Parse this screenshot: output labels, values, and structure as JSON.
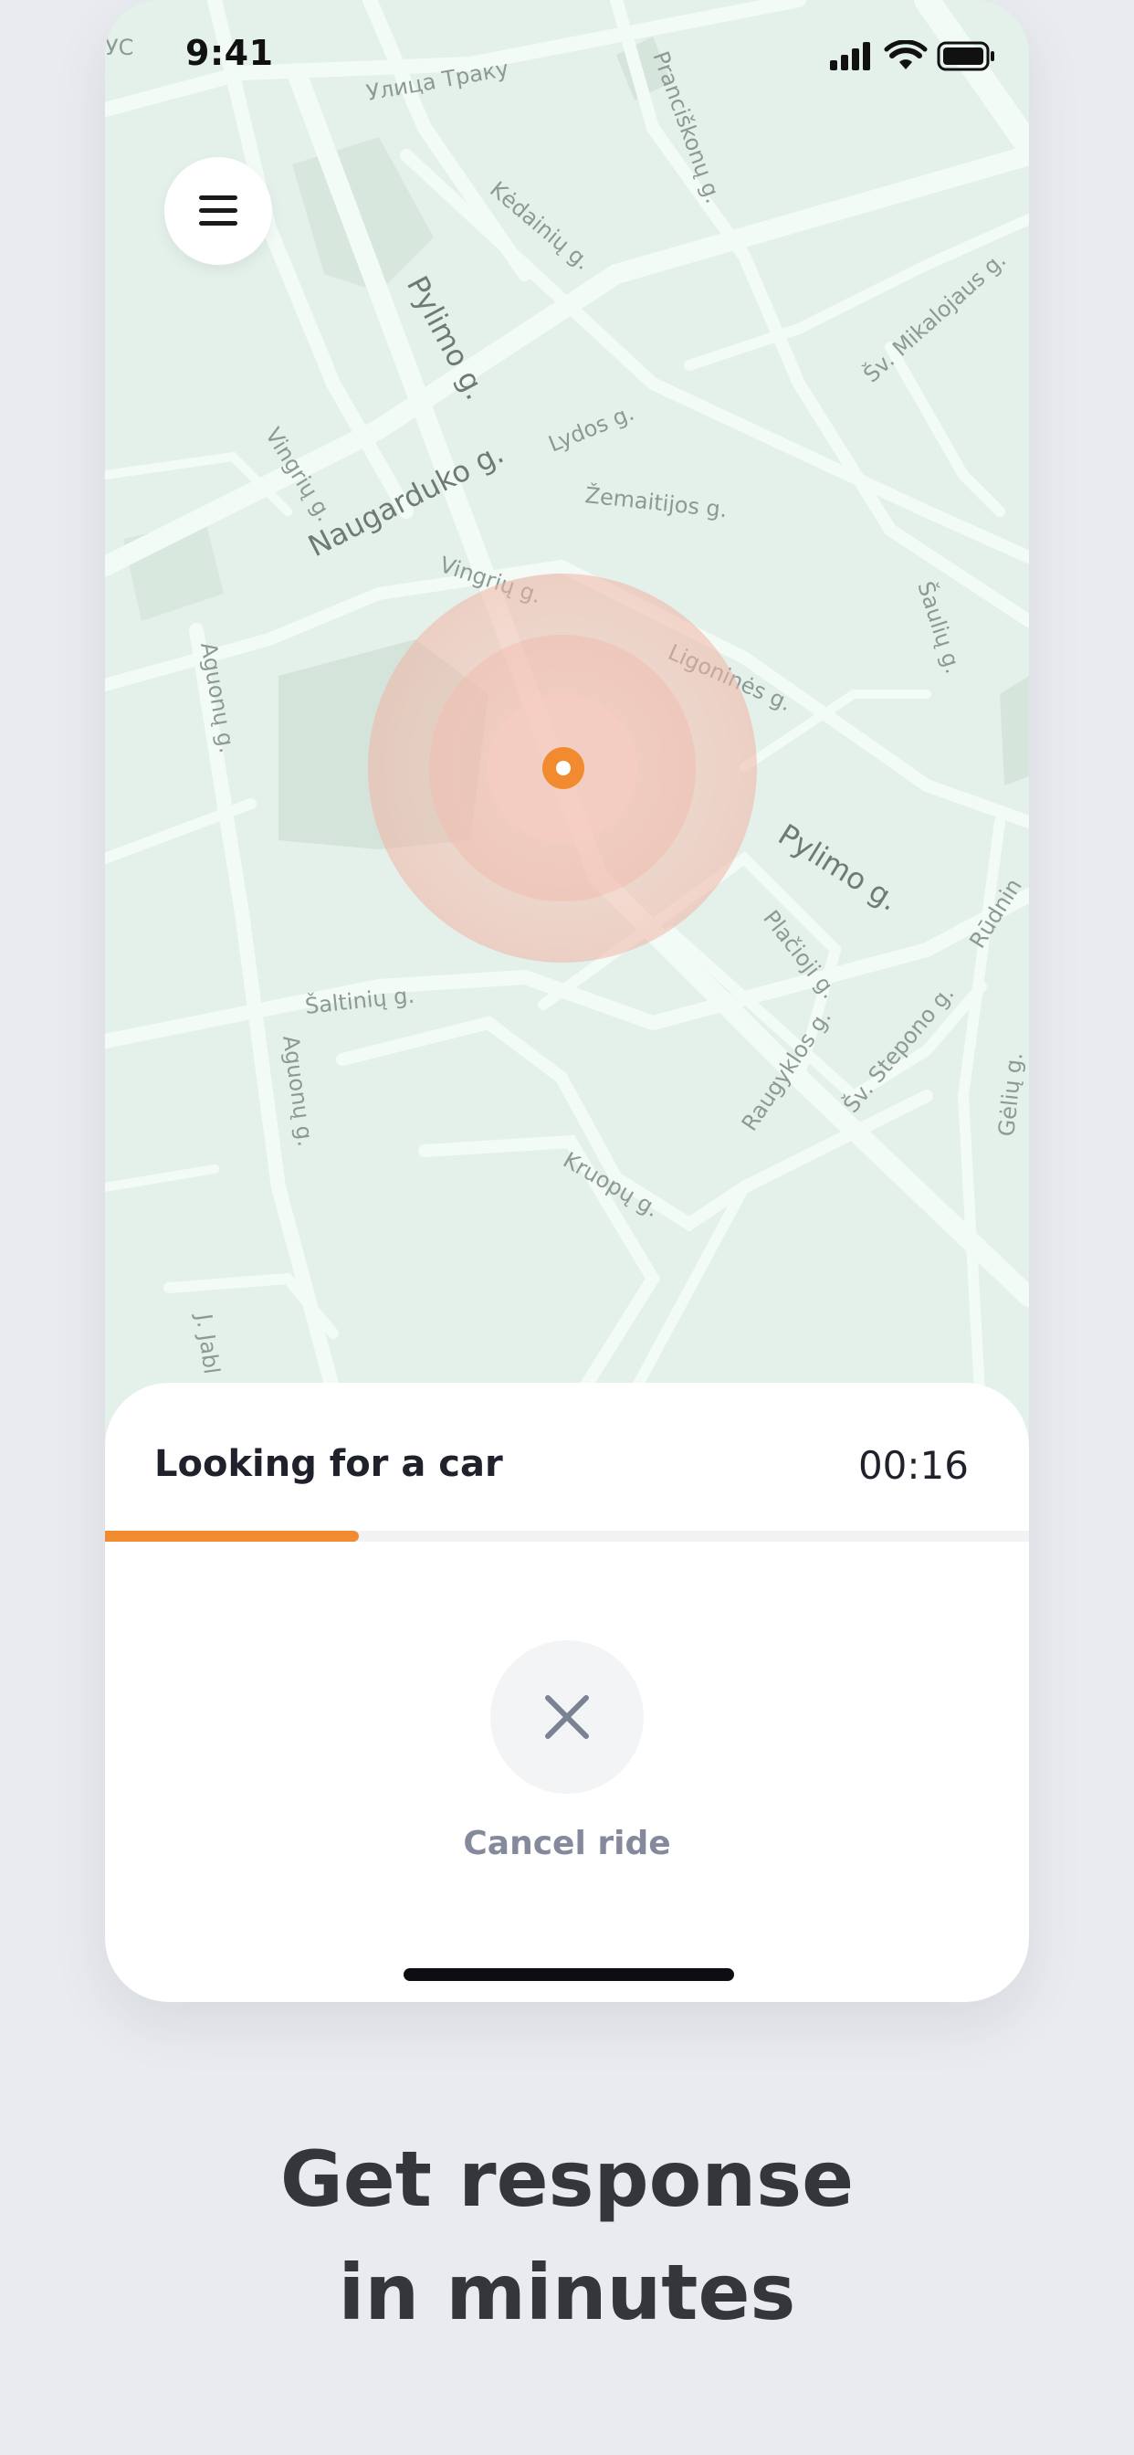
{
  "status_bar": {
    "time": "9:41",
    "icons": [
      "cellular-icon",
      "wifi-icon",
      "battery-icon"
    ]
  },
  "map": {
    "streets": [
      "Улица Траку",
      "Pranciškonų g.",
      "Kėdainių g.",
      "Pylimo g.",
      "Šv. Mikalojaus g.",
      "Lydos g.",
      "Vingrių g.",
      "Naugarduko g.",
      "Žemaitijos g.",
      "Vingrių g.",
      "Ligoninės g.",
      "Aguonų g.",
      "Šaulių g.",
      "Pylimo g.",
      "Plačioji g.",
      "Rūdnin",
      "Šaltinių g.",
      "Aguonų g.",
      "Raugyklos g.",
      "Šv. Stepono g.",
      "Gėlių g.",
      "Kruopų g.",
      "J. Jabl",
      "УС"
    ],
    "colors": {
      "land": "#e4f1ea",
      "road": "#f3fbf6",
      "park": "#d6e6dd",
      "pin": "#f28a2f"
    }
  },
  "menu_button": {
    "icon": "hamburger-icon"
  },
  "sheet": {
    "title": "Looking for a car",
    "timer": "00:16",
    "progress_fraction": 0.275,
    "cancel_label": "Cancel ride",
    "cancel_icon": "close-icon"
  },
  "headline": {
    "line1": "Get response",
    "line2": "in minutes"
  }
}
